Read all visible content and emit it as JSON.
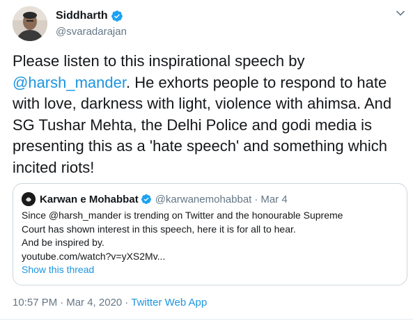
{
  "tweet": {
    "author_name": "Siddharth",
    "author_handle": "@svaradarajan",
    "body_line1": "Please listen to this inspirational speech by",
    "mention": "@harsh_mander",
    "body_rest": ". He exhorts people to respond to hate with love, darkness with light, violence with ahimsa. And SG Tushar Mehta, the Delhi Police and godi media is presenting this as a 'hate speech' and something which incited riots!",
    "time": "10:57 PM",
    "date": "Mar 4, 2020",
    "separator": "·",
    "source": "Twitter Web App"
  },
  "quoted": {
    "name": "Karwan e Mohabbat",
    "handle": "@karwanemohabbat",
    "separator": "·",
    "date": "Mar 4",
    "lines": [
      "Since @harsh_mander is trending on Twitter and the honourable Supreme",
      "Court has shown interest in this speech, here it is for all to hear.",
      "And be inspired by.",
      "youtube.com/watch?v=yXS2Mv..."
    ],
    "show_thread": "Show this thread"
  },
  "colors": {
    "accent": "#1b95e0",
    "verified": "#1da1f2",
    "secondary_text": "#657786",
    "border": "#ccd6dd"
  },
  "icons": {
    "verified": "verified-badge-icon",
    "menu": "chevron-down-icon"
  }
}
